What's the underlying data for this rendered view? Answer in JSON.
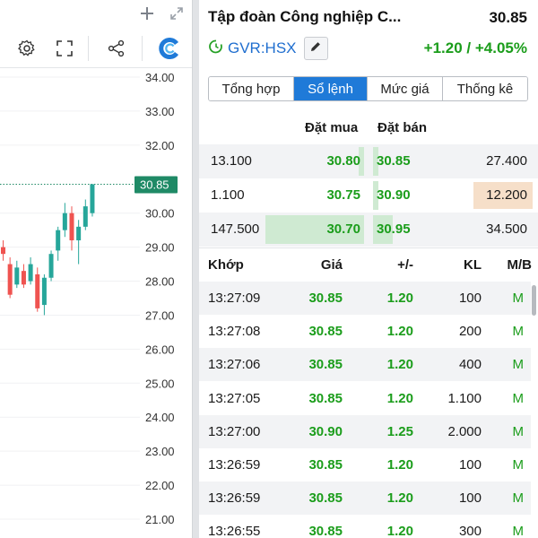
{
  "chart": {
    "y_ticks": [
      "34.00",
      "33.00",
      "32.00",
      "30.00",
      "29.00",
      "28.00",
      "27.00",
      "26.00",
      "25.00",
      "24.00",
      "23.00",
      "22.00",
      "21.00"
    ],
    "last_price_label": "30.85",
    "colors": {
      "up": "#26a69a",
      "down": "#ef5350",
      "badge": "#1f8a66",
      "grid": "#f0f1f3"
    }
  },
  "chart_data": {
    "type": "candlestick",
    "title": "",
    "ylim": [
      20.75,
      34.2
    ],
    "last_price": 30.85,
    "candles": [
      {
        "o": 29.0,
        "h": 29.2,
        "l": 28.6,
        "c": 28.8
      },
      {
        "o": 28.5,
        "h": 28.7,
        "l": 27.5,
        "c": 27.6
      },
      {
        "o": 27.9,
        "h": 28.6,
        "l": 27.8,
        "c": 28.4
      },
      {
        "o": 28.3,
        "h": 28.5,
        "l": 27.8,
        "c": 27.9
      },
      {
        "o": 28.0,
        "h": 28.7,
        "l": 27.9,
        "c": 28.5
      },
      {
        "o": 28.2,
        "h": 28.4,
        "l": 27.1,
        "c": 27.2
      },
      {
        "o": 27.3,
        "h": 28.2,
        "l": 27.0,
        "c": 28.1
      },
      {
        "o": 28.1,
        "h": 28.9,
        "l": 28.0,
        "c": 28.8
      },
      {
        "o": 28.9,
        "h": 29.6,
        "l": 28.6,
        "c": 29.5
      },
      {
        "o": 29.5,
        "h": 30.3,
        "l": 29.3,
        "c": 30.0
      },
      {
        "o": 30.0,
        "h": 30.2,
        "l": 28.9,
        "c": 29.2
      },
      {
        "o": 29.2,
        "h": 29.8,
        "l": 28.5,
        "c": 29.6
      },
      {
        "o": 29.6,
        "h": 30.4,
        "l": 29.5,
        "c": 30.2
      },
      {
        "o": 30.0,
        "h": 30.85,
        "l": 29.9,
        "c": 30.85
      }
    ]
  },
  "header": {
    "stock_name": "Tập đoàn Công nghiệp C...",
    "price": "30.85",
    "ticker": "GVR:HSX",
    "change": "+1.20 / +4.05%"
  },
  "tabs": [
    {
      "label": "Tổng hợp",
      "active": false
    },
    {
      "label": "Sổ lệnh",
      "active": true
    },
    {
      "label": "Mức giá",
      "active": false
    },
    {
      "label": "Thống kê",
      "active": false
    }
  ],
  "orderbook": {
    "bid_label": "Đặt mua",
    "ask_label": "Đặt bán",
    "rows": [
      {
        "bid_vol": "13.100",
        "bid_price": "30.80",
        "ask_price": "30.85",
        "ask_vol": "27.400",
        "bid_fill": 0.02,
        "ask_fill": 0.04,
        "ask_highlight": false
      },
      {
        "bid_vol": "1.100",
        "bid_price": "30.75",
        "ask_price": "30.90",
        "ask_vol": "12.200",
        "bid_fill": 0.0,
        "ask_fill": 0.04,
        "ask_highlight": true
      },
      {
        "bid_vol": "147.500",
        "bid_price": "30.70",
        "ask_price": "30.95",
        "ask_vol": "34.500",
        "bid_fill": 0.98,
        "ask_fill": 0.1,
        "ask_highlight": false
      }
    ]
  },
  "matches": {
    "headers": {
      "time": "Khớp",
      "price": "Giá",
      "change": "+/-",
      "vol": "KL",
      "side": "M/B"
    },
    "rows": [
      {
        "time": "13:27:09",
        "price": "30.85",
        "change": "1.20",
        "vol": "100",
        "side": "M"
      },
      {
        "time": "13:27:08",
        "price": "30.85",
        "change": "1.20",
        "vol": "200",
        "side": "M"
      },
      {
        "time": "13:27:06",
        "price": "30.85",
        "change": "1.20",
        "vol": "400",
        "side": "M"
      },
      {
        "time": "13:27:05",
        "price": "30.85",
        "change": "1.20",
        "vol": "1.100",
        "side": "M"
      },
      {
        "time": "13:27:00",
        "price": "30.90",
        "change": "1.25",
        "vol": "2.000",
        "side": "M"
      },
      {
        "time": "13:26:59",
        "price": "30.85",
        "change": "1.20",
        "vol": "100",
        "side": "M"
      },
      {
        "time": "13:26:59",
        "price": "30.85",
        "change": "1.20",
        "vol": "100",
        "side": "M"
      },
      {
        "time": "13:26:55",
        "price": "30.85",
        "change": "1.20",
        "vol": "300",
        "side": "M"
      }
    ]
  }
}
